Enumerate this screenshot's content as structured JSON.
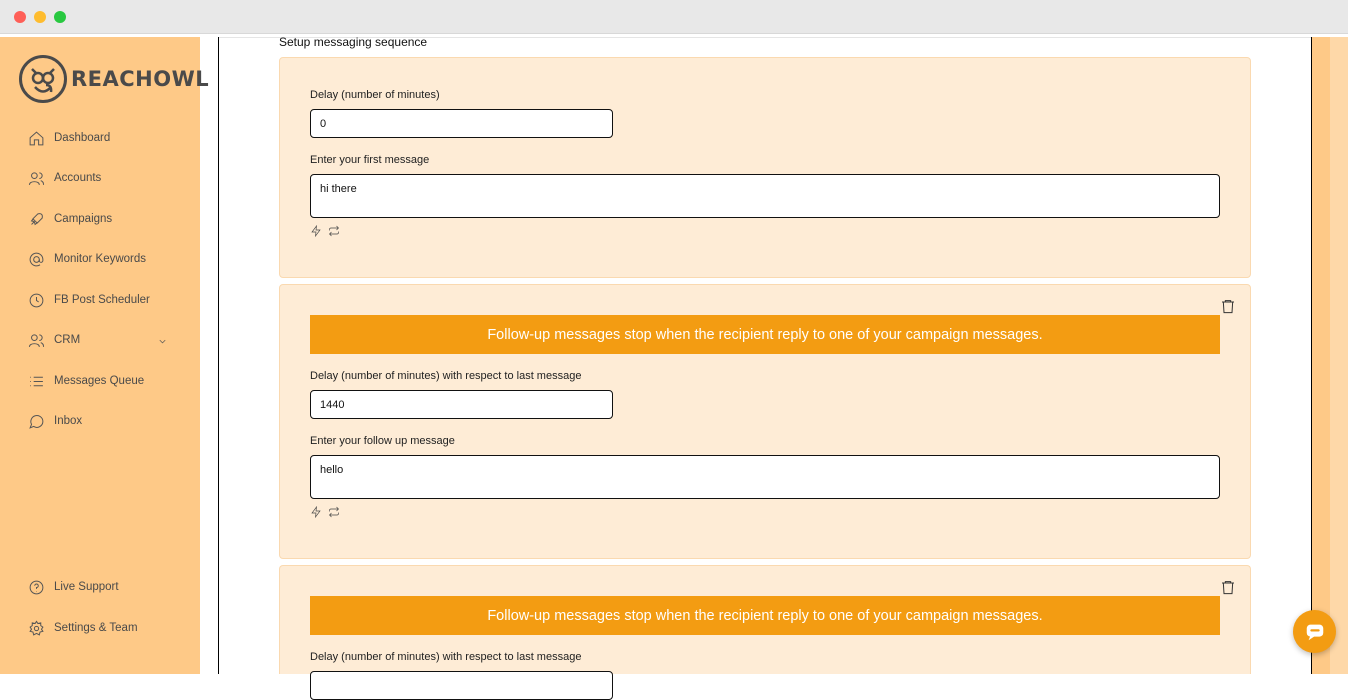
{
  "brand": {
    "name": "REACHOWL"
  },
  "sidebar": {
    "items": [
      {
        "label": "Dashboard",
        "icon": "home-icon"
      },
      {
        "label": "Accounts",
        "icon": "users-icon"
      },
      {
        "label": "Campaigns",
        "icon": "rocket-icon"
      },
      {
        "label": "Monitor Keywords",
        "icon": "at-icon"
      },
      {
        "label": "FB Post Scheduler",
        "icon": "clock-icon"
      },
      {
        "label": "CRM",
        "icon": "users-icon"
      },
      {
        "label": "Messages Queue",
        "icon": "list-icon"
      },
      {
        "label": "Inbox",
        "icon": "chat-icon"
      }
    ],
    "bottom": [
      {
        "label": "Live Support",
        "icon": "help-icon"
      },
      {
        "label": "Settings & Team",
        "icon": "gear-icon"
      }
    ]
  },
  "main": {
    "section_title": "Setup messaging sequence",
    "first": {
      "delay_label": "Delay (number of minutes)",
      "delay_value": "0",
      "message_label": "Enter your first message",
      "message_value": "hi there"
    },
    "followups": [
      {
        "banner": "Follow-up messages stop when the recipient reply to one of your campaign messages.",
        "delay_label": "Delay (number of minutes) with respect to last message",
        "delay_value": "1440",
        "message_label": "Enter your follow up message",
        "message_value": "hello"
      },
      {
        "banner": "Follow-up messages stop when the recipient reply to one of your campaign messages.",
        "delay_label": "Delay (number of minutes) with respect to last message"
      }
    ]
  },
  "colors": {
    "sidebar": "#fec987",
    "card": "#feecd6",
    "accent": "#f39c12"
  }
}
